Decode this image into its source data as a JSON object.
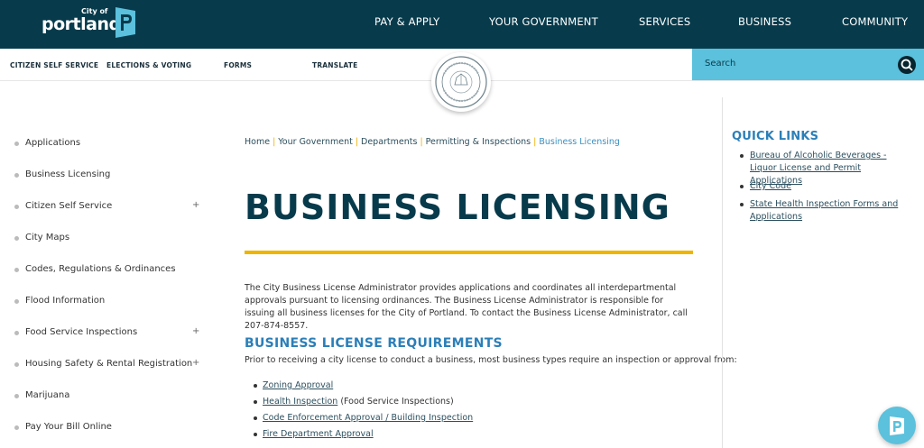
{
  "header": {
    "logo": {
      "city": "City of",
      "name": "portland",
      "mark_icon": "portland-p-icon"
    },
    "nav": [
      "PAY & APPLY",
      "YOUR GOVERNMENT",
      "SERVICES",
      "BUSINESS",
      "COMMUNITY"
    ],
    "colors": {
      "bar": "#073b4c",
      "accent": "#5bc1dc"
    }
  },
  "subnav": {
    "links": [
      "CITIZEN SELF SERVICE",
      "ELECTIONS & VOTING",
      "FORMS",
      "TRANSLATE"
    ],
    "search": {
      "placeholder": "Search",
      "icon": "search-icon"
    },
    "seal_icon": "city-seal-icon"
  },
  "sidebar": {
    "items": [
      {
        "label": "Applications",
        "expandable": false
      },
      {
        "label": "Business Licensing",
        "expandable": false
      },
      {
        "label": "Citizen Self Service",
        "expandable": true
      },
      {
        "label": "City Maps",
        "expandable": false
      },
      {
        "label": "Codes, Regulations & Ordinances",
        "expandable": false
      },
      {
        "label": "Flood Information",
        "expandable": false
      },
      {
        "label": "Food Service Inspections",
        "expandable": true
      },
      {
        "label": "Housing Safety & Rental Registration",
        "expandable": true
      },
      {
        "label": "Marijuana",
        "expandable": false
      },
      {
        "label": "Pay Your Bill Online",
        "expandable": false
      }
    ],
    "expand_symbol": "+"
  },
  "breadcrumb": {
    "items": [
      "Home",
      "Your Government",
      "Departments",
      "Permitting & Inspections"
    ],
    "current": "Business Licensing",
    "separator": "|"
  },
  "main": {
    "title": "BUSINESS LICENSING",
    "intro": "The City Business License Administrator provides applications and coordinates all interdepartmental approvals pursuant to licensing ordinances. The Business License Administrator is responsible for issuing all business licenses for the City of Portland. To contact the Business License Administrator, call 207-874-8557.",
    "section_heading": "BUSINESS LICENSE REQUIREMENTS",
    "section_intro": "Prior to receiving a city license to conduct a business, most business types require an inspection or approval from:",
    "requirements": [
      {
        "link": "Zoning Approval",
        "note": ""
      },
      {
        "link": "Health Inspection",
        "note": " (Food Service Inspections)"
      },
      {
        "link": "Code Enforcement Approval / Building Inspection",
        "note": ""
      },
      {
        "link": "Fire Department Approval",
        "note": ""
      }
    ]
  },
  "quick_links": {
    "title": "QUICK LINKS",
    "items": [
      "Bureau of Alcoholic Beverages - Liquor License and Permit Applications",
      "City Code",
      "State Health Inspection Forms and Applications"
    ]
  },
  "fab": {
    "icon": "portland-p-icon"
  }
}
